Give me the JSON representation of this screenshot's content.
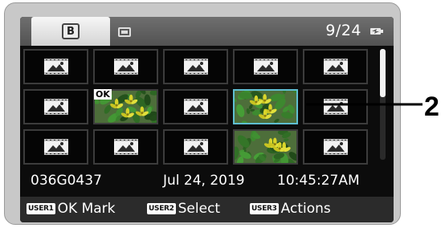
{
  "header": {
    "media_slot_label": "B",
    "tab_card_icon": "memory-card-icon",
    "counter": "9/24",
    "battery_icon": "battery-icon"
  },
  "grid": {
    "columns": 5,
    "rows": 3,
    "thumbnails": [
      {
        "type": "placeholder",
        "ok": false,
        "selected": false
      },
      {
        "type": "placeholder",
        "ok": false,
        "selected": false
      },
      {
        "type": "placeholder",
        "ok": false,
        "selected": false
      },
      {
        "type": "placeholder",
        "ok": false,
        "selected": false
      },
      {
        "type": "placeholder",
        "ok": false,
        "selected": false
      },
      {
        "type": "placeholder",
        "ok": false,
        "selected": false
      },
      {
        "type": "photo",
        "ok": true,
        "selected": false,
        "ok_label": "OK"
      },
      {
        "type": "placeholder",
        "ok": false,
        "selected": false
      },
      {
        "type": "photo",
        "ok": false,
        "selected": true
      },
      {
        "type": "placeholder",
        "ok": false,
        "selected": false
      },
      {
        "type": "placeholder",
        "ok": false,
        "selected": false
      },
      {
        "type": "placeholder",
        "ok": false,
        "selected": false
      },
      {
        "type": "placeholder",
        "ok": false,
        "selected": false
      },
      {
        "type": "photo",
        "ok": false,
        "selected": false
      },
      {
        "type": "placeholder",
        "ok": false,
        "selected": false
      }
    ]
  },
  "info": {
    "clip_name": "036G0437",
    "date": "Jul 24, 2019",
    "time": "10:45:27AM"
  },
  "buttons": [
    {
      "badge": "USER1",
      "label": "OK Mark"
    },
    {
      "badge": "USER2",
      "label": "Select"
    },
    {
      "badge": "USER3",
      "label": "Actions"
    }
  ],
  "callout": {
    "number": "2"
  },
  "colors": {
    "selection": "#5fbfd1",
    "screen": "#0c0c0c",
    "bezel": "#c8c8c8"
  }
}
